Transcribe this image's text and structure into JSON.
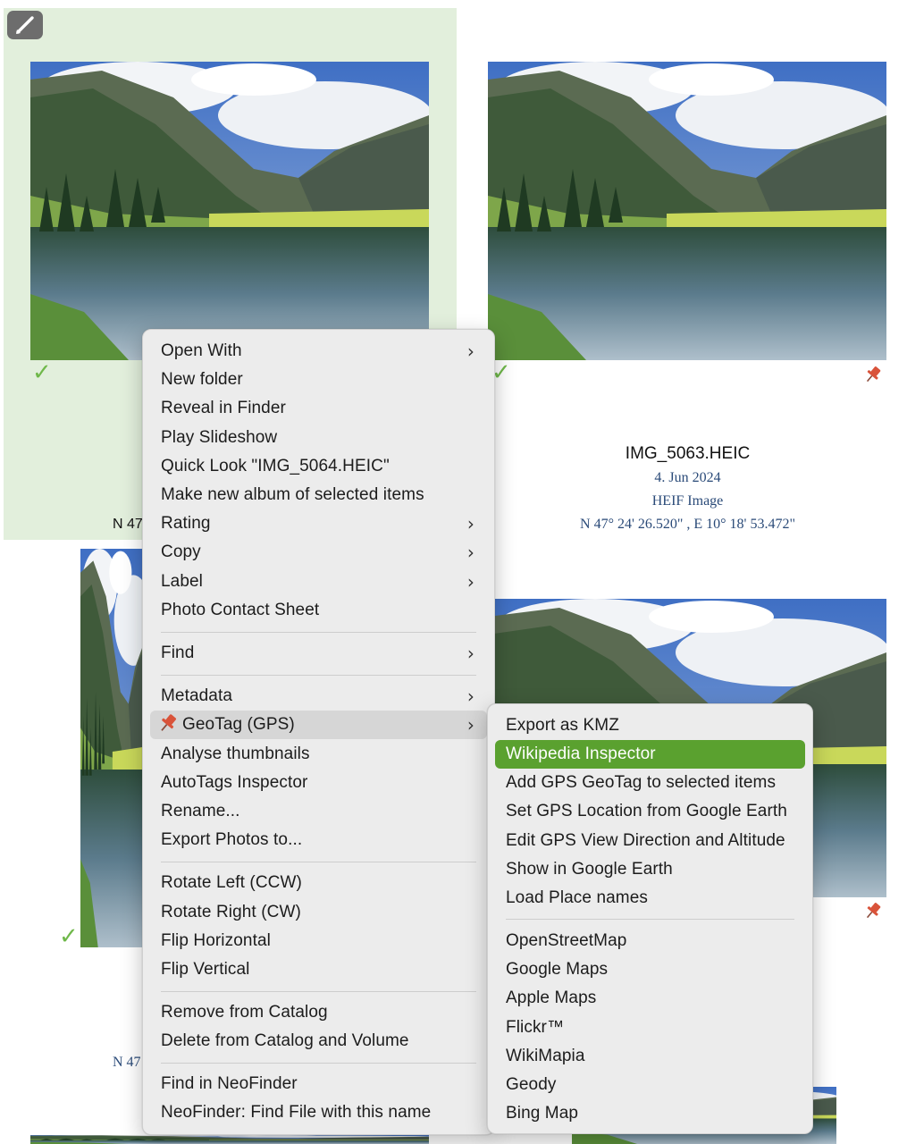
{
  "thumbnails": {
    "top_right": {
      "filename": "IMG_5063.HEIC",
      "date": "4. Jun 2024",
      "kind": "HEIF Image",
      "coordinates": "N 47° 24' 26.520\" , E 10° 18' 53.472\""
    },
    "top_left_coord_fragment": "N 47",
    "bottom_left_coord_fragment": "N 47"
  },
  "context_menu": {
    "items": [
      {
        "label": "Open With",
        "submenu": true
      },
      {
        "label": "New folder"
      },
      {
        "label": "Reveal in Finder"
      },
      {
        "label": "Play Slideshow"
      },
      {
        "label": "Quick Look \"IMG_5064.HEIC\""
      },
      {
        "label": "Make new album of selected items"
      },
      {
        "label": "Rating",
        "submenu": true
      },
      {
        "label": "Copy",
        "submenu": true
      },
      {
        "label": "Label",
        "submenu": true
      },
      {
        "label": "Photo Contact Sheet"
      },
      {
        "label": "Find",
        "submenu": true
      },
      {
        "label": "Metadata",
        "submenu": true
      },
      {
        "label": "GeoTag (GPS)",
        "submenu": true,
        "icon": "pin-icon",
        "highlighted": true
      },
      {
        "label": "Analyse thumbnails"
      },
      {
        "label": "AutoTags Inspector"
      },
      {
        "label": "Rename..."
      },
      {
        "label": "Export Photos to..."
      },
      {
        "label": "Rotate Left (CCW)"
      },
      {
        "label": "Rotate Right (CW)"
      },
      {
        "label": "Flip Horizontal"
      },
      {
        "label": "Flip Vertical"
      },
      {
        "label": "Remove from Catalog"
      },
      {
        "label": "Delete from Catalog and Volume"
      },
      {
        "label": "Find in NeoFinder"
      },
      {
        "label": "NeoFinder: Find File with this name"
      }
    ]
  },
  "geotag_submenu": {
    "items": [
      {
        "label": "Export as KMZ"
      },
      {
        "label": "Wikipedia Inspector",
        "selected": true
      },
      {
        "label": "Add GPS GeoTag to selected items"
      },
      {
        "label": "Set GPS Location from Google Earth"
      },
      {
        "label": "Edit GPS View Direction and Altitude"
      },
      {
        "label": "Show in Google Earth"
      },
      {
        "label": "Load Place names"
      },
      {
        "label": "OpenStreetMap"
      },
      {
        "label": "Google Maps"
      },
      {
        "label": "Apple Maps"
      },
      {
        "label": "Flickr™"
      },
      {
        "label": "WikiMapia"
      },
      {
        "label": "Geody"
      },
      {
        "label": "Bing Map"
      }
    ]
  },
  "colors": {
    "selection_background": "#e2efdc",
    "menu_background": "#ececec",
    "active_item": "#5aa12f",
    "check": "#6fb84a",
    "pin": "#d9533a",
    "metadata_text": "#2a4a78"
  }
}
